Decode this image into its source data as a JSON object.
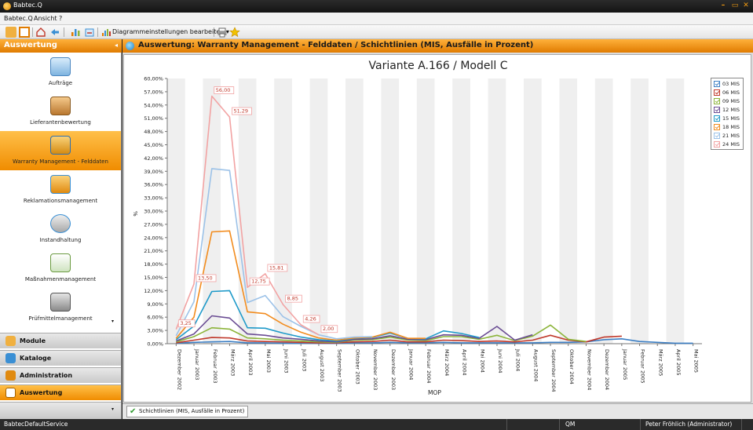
{
  "window": {
    "title": "Babtec.Q"
  },
  "menu": {
    "items": [
      "Babtec.Q",
      "Ansicht",
      "?"
    ]
  },
  "toolbar": {
    "diagram_settings_label": "Diagrammeinstellungen bearbeiten"
  },
  "sidebar": {
    "header": "Auswertung",
    "items": [
      {
        "label": "Aufträge",
        "icon": "orders-icon"
      },
      {
        "label": "Lieferantenbewertung",
        "icon": "supplier-rating-icon"
      },
      {
        "label": "Warranty Management - Felddaten",
        "icon": "warranty-icon",
        "active": true
      },
      {
        "label": "Reklamationsmanagement",
        "icon": "complaints-icon"
      },
      {
        "label": "Instandhaltung",
        "icon": "maintenance-icon"
      },
      {
        "label": "Maßnahmenmanagement",
        "icon": "measures-icon"
      },
      {
        "label": "Prüfmittelmanagement",
        "icon": "test-equipment-icon"
      }
    ],
    "groups": [
      {
        "label": "Module",
        "icon": "modules-icon"
      },
      {
        "label": "Kataloge",
        "icon": "catalogs-icon"
      },
      {
        "label": "Administration",
        "icon": "administration-icon"
      },
      {
        "label": "Auswertung",
        "icon": "analysis-icon",
        "active": true
      }
    ]
  },
  "content": {
    "header": "Auswertung: Warranty Management - Felddaten / Schichtlinien (MIS, Ausfälle in Prozent)",
    "tab_label": "Schichtlinien (MIS, Ausfälle in Prozent)"
  },
  "status": {
    "service": "BabtecDefaultService",
    "module": "QM",
    "user": "Peter Fröhlich (Administrator)"
  },
  "chart_data": {
    "type": "line",
    "title": "Variante A.166 / Modell C",
    "xlabel": "MOP",
    "ylabel": "%",
    "ylim": [
      0,
      60
    ],
    "yticks": [
      "0,00%",
      "3,00%",
      "6,00%",
      "9,00%",
      "12,00%",
      "15,00%",
      "18,00%",
      "21,00%",
      "24,00%",
      "27,00%",
      "30,00%",
      "33,00%",
      "36,00%",
      "39,00%",
      "42,00%",
      "45,00%",
      "48,00%",
      "51,00%",
      "54,00%",
      "57,00%",
      "60,00%"
    ],
    "grid": "alternating vertical bands",
    "legend_position": "right",
    "categories": [
      "Dezember 2002",
      "Januar 2003",
      "Februar 2003",
      "März 2003",
      "April 2003",
      "Mai 2003",
      "Juni 2003",
      "Juli 2003",
      "August 2003",
      "September 2003",
      "Oktober 2003",
      "November 2003",
      "Dezember 2003",
      "Januar 2004",
      "Februar 2004",
      "März 2004",
      "April 2004",
      "Mai 2004",
      "Juni 2004",
      "Juli 2004",
      "August 2004",
      "September 2004",
      "Oktober 2004",
      "November 2004",
      "Dezember 2004",
      "Januar 2005",
      "Februar 2005",
      "März 2005",
      "April 2005",
      "Mai 2005"
    ],
    "series": [
      {
        "name": "03 MIS",
        "color": "#3d7fc4",
        "values": [
          0.1,
          0.3,
          0.4,
          0.5,
          0.2,
          0.2,
          0.1,
          0.1,
          0.1,
          0.1,
          0.2,
          0.2,
          0.3,
          0.2,
          0.2,
          0.3,
          0.2,
          0.2,
          0.2,
          0.2,
          0.2,
          0.3,
          0.3,
          0.4,
          0.9,
          1.1,
          0.5,
          0.3,
          0.1,
          0.1
        ]
      },
      {
        "name": "06 MIS",
        "color": "#c0392b",
        "values": [
          0.2,
          0.8,
          1.4,
          1.3,
          0.6,
          0.5,
          0.4,
          0.3,
          0.2,
          0.2,
          0.4,
          0.5,
          0.8,
          0.4,
          0.4,
          0.8,
          0.7,
          0.5,
          0.6,
          0.4,
          0.8,
          1.9,
          0.8,
          0.4,
          1.5,
          1.7,
          null,
          null,
          null,
          null
        ]
      },
      {
        "name": "09 MIS",
        "color": "#8cb43a",
        "values": [
          0.4,
          1.6,
          3.6,
          3.3,
          1.3,
          1.1,
          0.8,
          0.6,
          0.4,
          0.3,
          0.8,
          0.9,
          1.5,
          0.8,
          0.7,
          1.6,
          1.6,
          1.0,
          1.9,
          0.7,
          1.7,
          4.2,
          1.0,
          0.5,
          null,
          null,
          null,
          null,
          null,
          null
        ]
      },
      {
        "name": "12 MIS",
        "color": "#6a4c93",
        "values": [
          0.6,
          2.2,
          6.3,
          5.8,
          2.2,
          1.9,
          1.3,
          1.0,
          0.6,
          0.4,
          1.0,
          1.1,
          1.8,
          1.0,
          0.9,
          2.0,
          1.9,
          1.2,
          3.9,
          0.8,
          2.0,
          null,
          null,
          null,
          null,
          null,
          null,
          null,
          null,
          null
        ]
      },
      {
        "name": "15 MIS",
        "color": "#1f9ac9",
        "values": [
          0.9,
          4.0,
          11.8,
          12.0,
          3.6,
          3.5,
          2.4,
          1.5,
          0.9,
          0.6,
          1.2,
          1.4,
          2.4,
          1.2,
          1.1,
          2.9,
          2.3,
          1.4,
          null,
          null,
          null,
          null,
          null,
          null,
          null,
          null,
          null,
          null,
          null,
          null
        ]
      },
      {
        "name": "18 MIS",
        "color": "#f28c1e",
        "values": [
          1.2,
          6.0,
          25.3,
          25.5,
          7.2,
          6.8,
          4.4,
          2.6,
          1.3,
          0.8,
          1.3,
          1.5,
          2.6,
          1.2,
          1.2,
          null,
          null,
          null,
          null,
          null,
          null,
          null,
          null,
          null,
          null,
          null,
          null,
          null,
          null,
          null
        ]
      },
      {
        "name": "21 MIS",
        "color": "#9cc2e8",
        "values": [
          1.8,
          9.5,
          39.6,
          39.2,
          9.3,
          10.9,
          6.1,
          3.9,
          2.0,
          1.1,
          1.5,
          1.6,
          null,
          null,
          null,
          null,
          null,
          null,
          null,
          null,
          null,
          null,
          null,
          null,
          null,
          null,
          null,
          null,
          null,
          null
        ]
      },
      {
        "name": "24 MIS",
        "color": "#f2a3a3",
        "values": [
          3.25,
          13.5,
          56.0,
          51.29,
          12.75,
          15.81,
          8.85,
          4.26,
          2.0,
          null,
          null,
          null,
          null,
          null,
          null,
          null,
          null,
          null,
          null,
          null,
          null,
          null,
          null,
          null,
          null,
          null,
          null,
          null,
          null,
          null
        ]
      }
    ],
    "data_labels": [
      {
        "series": "24 MIS",
        "category": "Dezember 2002",
        "text": "3,25"
      },
      {
        "series": "24 MIS",
        "category": "Januar 2003",
        "text": "13,50"
      },
      {
        "series": "24 MIS",
        "category": "Februar 2003",
        "text": "56,00"
      },
      {
        "series": "24 MIS",
        "category": "März 2003",
        "text": "51,29"
      },
      {
        "series": "24 MIS",
        "category": "April 2003",
        "text": "12,75"
      },
      {
        "series": "24 MIS",
        "category": "Mai 2003",
        "text": "15,81"
      },
      {
        "series": "24 MIS",
        "category": "Juni 2003",
        "text": "8,85"
      },
      {
        "series": "24 MIS",
        "category": "Juli 2003",
        "text": "4,26"
      },
      {
        "series": "24 MIS",
        "category": "August 2003",
        "text": "2,00"
      }
    ]
  }
}
